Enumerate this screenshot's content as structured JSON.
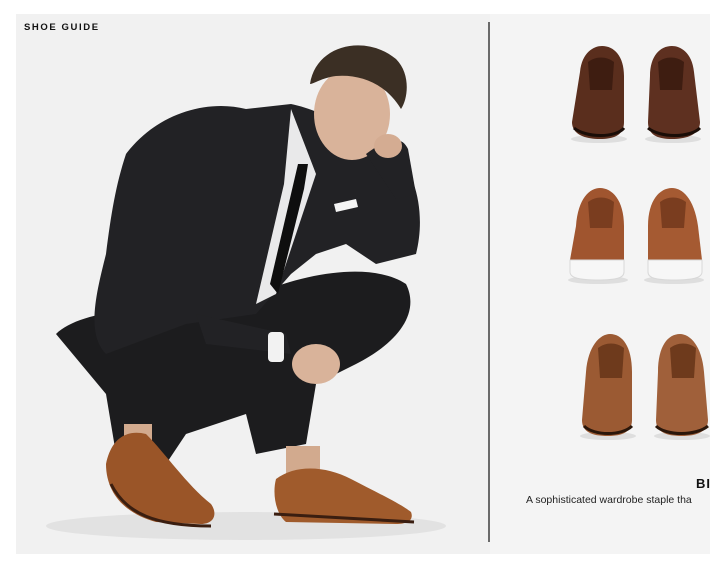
{
  "header": {
    "title": "SHOE GUIDE"
  },
  "hero": {
    "image": "man in black suit crouching wearing brown brogues"
  },
  "products": [
    {
      "name": "dark-brown-cap-toe-oxford",
      "color": "#5a2e1d"
    },
    {
      "name": "tan-wingtip-sneaker",
      "color": "#a0552f"
    },
    {
      "name": "tan-wingtip-brogue",
      "color": "#9b5a33"
    }
  ],
  "caption": {
    "title": "BI",
    "description": "A sophisticated wardrobe staple tha"
  },
  "colors": {
    "background": "#f1f1f1",
    "divider": "#6a6a6a",
    "text": "#111111"
  }
}
